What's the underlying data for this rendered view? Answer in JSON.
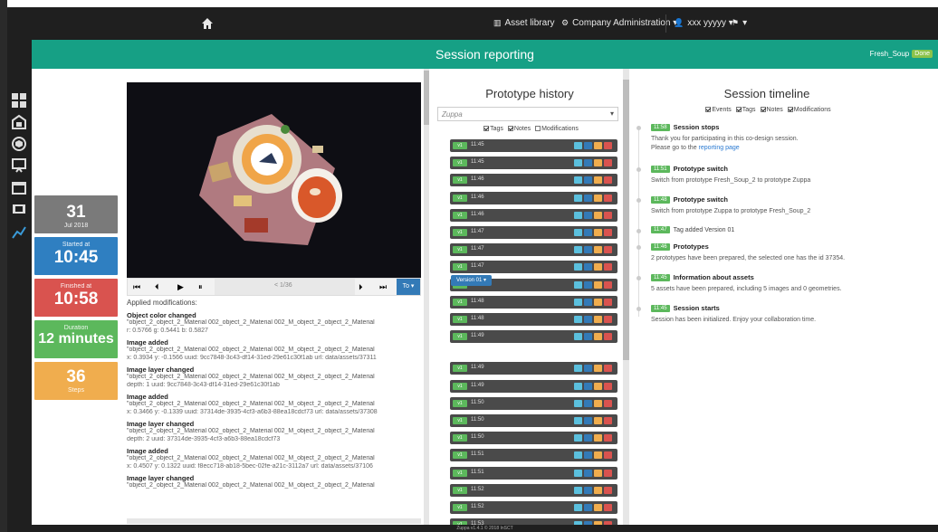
{
  "topbar": {
    "asset_library": "Asset library",
    "company_admin": "Company Administration ▾",
    "user": "xxx yyyyy ▾",
    "flag_menu": "▾"
  },
  "header": {
    "title": "Session reporting",
    "right_label": "Fresh_Soup",
    "right_badge": "Done"
  },
  "stats": {
    "date": {
      "big": "31",
      "small": "Jul 2018",
      "color": "#7a7a7a"
    },
    "started": {
      "small": "Started at",
      "big": "10:45",
      "color": "#2f7fc1"
    },
    "finished": {
      "small": "Finished at",
      "big": "10:58",
      "color": "#d9534f"
    },
    "duration": {
      "small": "Duration",
      "big": "12 minutes",
      "color": "#5cb85c"
    },
    "steps": {
      "big": "36",
      "small": "Steps",
      "color": "#f0ad4e"
    }
  },
  "player": {
    "first": "⏮",
    "prev": "⏴",
    "play": "▶",
    "pause": "⏸",
    "counter": "< 1/36",
    "next": "⏵",
    "last": "⏭",
    "button": "To ▾"
  },
  "modifications": {
    "heading": "Applied modifications:",
    "entries": [
      {
        "title": "Object color changed",
        "path": "\"object_2_object_2_Material 002_object_2_Material 002_M_object_2_object_2_Material",
        "detail": "r: 0.5766 g: 0.5441 b: 0.5827"
      },
      {
        "title": "Image added",
        "path": "\"object_2_object_2_Material 002_object_2_Material 002_M_object_2_object_2_Material",
        "detail": "x: 0.3934 y: -0.1566 uuid: 9cc7848-3c43-df14-31ed-29e61c30f1ab url: data/assets/37311"
      },
      {
        "title": "Image layer changed",
        "path": "\"object_2_object_2_Material 002_object_2_Material 002_M_object_2_object_2_Material",
        "detail": "depth: 1 uuid: 9cc7848-3c43-df14-31ed-29e61c30f1ab"
      },
      {
        "title": "Image added",
        "path": "\"object_2_object_2_Material 002_object_2_Material 002_M_object_2_object_2_Material",
        "detail": "x: 0.3466 y: -0.1339 uuid: 37314de-3935-4cf3-a6b3-88ea18cdcf73 url: data/assets/37308"
      },
      {
        "title": "Image layer changed",
        "path": "\"object_2_object_2_Material 002_object_2_Material 002_M_object_2_object_2_Material",
        "detail": "depth: 2 uuid: 37314de-3935-4cf3-a6b3-88ea18cdcf73"
      },
      {
        "title": "Image added",
        "path": "\"object_2_object_2_Material 002_object_2_Material 002_M_object_2_object_2_Material",
        "detail": "x: 0.4507 y: 0.1322 uuid: f8ecc718-ab18-5bec-02fe-a21c-3112a7 url: data/assets/37106"
      },
      {
        "title": "Image layer changed",
        "path": "\"object_2_object_2_Material 002_object_2_Material 002_M_object_2_object_2_Material",
        "detail": ""
      }
    ]
  },
  "prototype": {
    "title": "Prototype history",
    "select_value": "Zuppa",
    "filters": [
      "Tags",
      "Notes",
      "Modifications"
    ],
    "rows": [
      {
        "badge": "v1",
        "time": "11:45"
      },
      {
        "badge": "v1",
        "time": "11:45"
      },
      {
        "badge": "v1",
        "time": "11:46"
      },
      {
        "badge": "v1",
        "time": "11:46"
      },
      {
        "badge": "v1",
        "time": "11:46"
      },
      {
        "badge": "v1",
        "time": "11:47"
      },
      {
        "badge": "v1",
        "time": "11:47"
      },
      {
        "badge": "v1",
        "time": "11:47"
      },
      {
        "badge": "v1",
        "time": "11:48"
      },
      {
        "badge": "v1",
        "time": "11:48"
      },
      {
        "badge": "v1",
        "time": "11:48"
      },
      {
        "badge": "v1",
        "time": "11:49"
      },
      {
        "badge": "v1",
        "time": "11:49"
      },
      {
        "badge": "v1",
        "time": "11:49"
      },
      {
        "badge": "v1",
        "time": "11:50"
      },
      {
        "badge": "v1",
        "time": "11:50"
      },
      {
        "badge": "v1",
        "time": "11:50"
      },
      {
        "badge": "v1",
        "time": "11:51"
      },
      {
        "badge": "v1",
        "time": "11:51"
      },
      {
        "badge": "v1",
        "time": "11:52"
      },
      {
        "badge": "v1",
        "time": "11:52"
      },
      {
        "badge": "v1",
        "time": "11:53"
      }
    ],
    "version_tag": "Version 01 ▾"
  },
  "timeline": {
    "title": "Session timeline",
    "filters": [
      "Events",
      "Tags",
      "Notes",
      "Modifications"
    ],
    "entries": [
      {
        "time": "11:58",
        "title": "Session stops",
        "body": "Thank you for participating in this co-design session.",
        "body2": "Please go to the ",
        "link": "reporting page"
      },
      {
        "time": "11:51",
        "title": "Prototype switch",
        "body": "Switch from prototype Fresh_Soup_2 to prototype Zuppa",
        "body2": "",
        "link": ""
      },
      {
        "time": "11:48",
        "title": "Prototype switch",
        "body": "Switch from prototype Zuppa to prototype Fresh_Soup_2",
        "body2": "",
        "link": ""
      },
      {
        "time": "11:47",
        "title": "Tag added  Version 01",
        "body": "",
        "body2": "",
        "link": ""
      },
      {
        "time": "11:46",
        "title": "Prototypes",
        "body": "2 prototypes have been prepared, the selected one has the id 37354.",
        "body2": "",
        "link": ""
      },
      {
        "time": "11:45",
        "title": "Information about assets",
        "body": "5 assets have been prepared, including 5 images and 0 geometries.",
        "body2": "",
        "link": ""
      },
      {
        "time": "11:45",
        "title": "Session starts",
        "body": "Session has been initialized. Enjoy your collaboration time.",
        "body2": "",
        "link": ""
      }
    ]
  },
  "footer": {
    "text": "Zuppa v1.4.1 © 2018 InSCT"
  }
}
